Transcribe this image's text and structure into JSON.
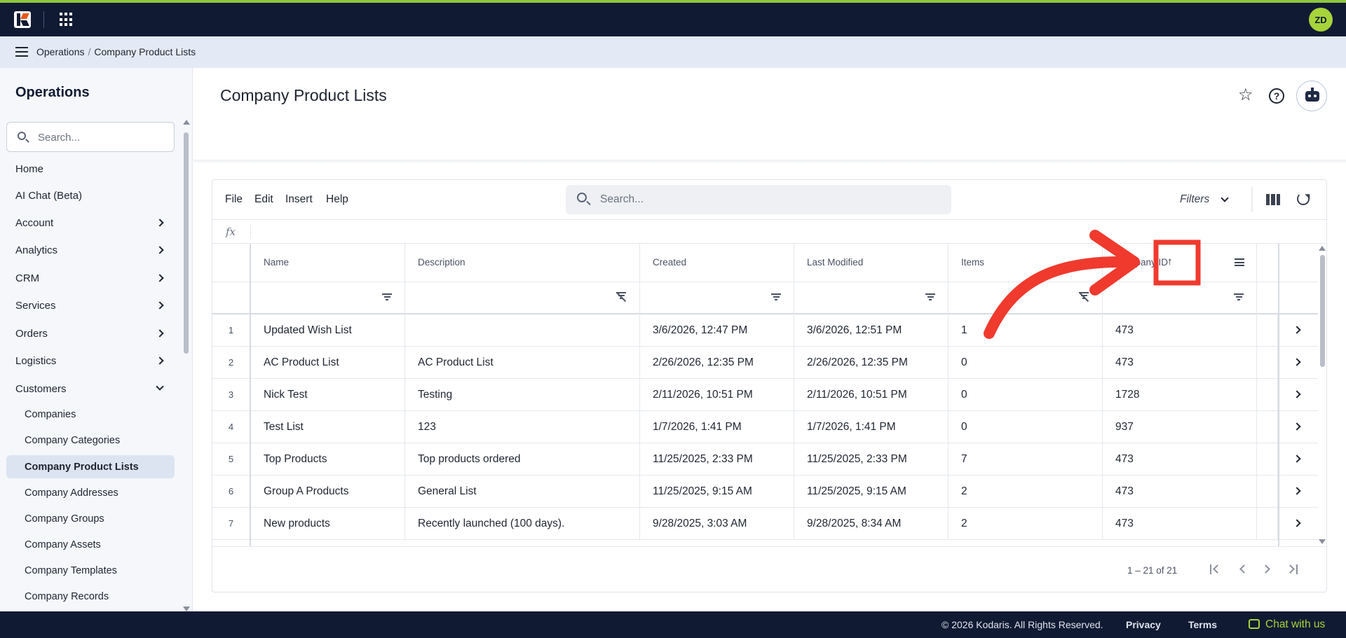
{
  "header": {
    "avatar_initials": "ZD"
  },
  "breadcrumb": {
    "items": [
      "Operations",
      "Company Product Lists"
    ]
  },
  "sidebar": {
    "title": "Operations",
    "search_placeholder": "Search...",
    "items": [
      {
        "label": "Home"
      },
      {
        "label": "AI Chat (Beta)"
      },
      {
        "label": "Account"
      },
      {
        "label": "Analytics"
      },
      {
        "label": "CRM"
      },
      {
        "label": "Services"
      },
      {
        "label": "Orders"
      },
      {
        "label": "Logistics"
      },
      {
        "label": "Customers"
      }
    ],
    "sub_items": [
      {
        "label": "Companies"
      },
      {
        "label": "Company Categories"
      },
      {
        "label": "Company Product Lists"
      },
      {
        "label": "Company Addresses"
      },
      {
        "label": "Company Groups"
      },
      {
        "label": "Company Assets"
      },
      {
        "label": "Company Templates"
      },
      {
        "label": "Company Records"
      }
    ]
  },
  "page": {
    "title": "Company Product Lists"
  },
  "toolbar": {
    "menu": [
      "File",
      "Edit",
      "Insert",
      "Help"
    ],
    "search_placeholder": "Search...",
    "filters_label": "Filters"
  },
  "formula_bar": {
    "label": "fx"
  },
  "table": {
    "columns": [
      "Name",
      "Description",
      "Created",
      "Last Modified",
      "Items",
      "Company ID"
    ],
    "rows": [
      {
        "num": "1",
        "name": "Updated Wish List",
        "description": "",
        "created": "3/6/2026, 12:47 PM",
        "modified": "3/6/2026, 12:51 PM",
        "items": "1",
        "company_id": "473"
      },
      {
        "num": "2",
        "name": "AC Product List",
        "description": "AC Product List",
        "created": "2/26/2026, 12:35 PM",
        "modified": "2/26/2026, 12:35 PM",
        "items": "0",
        "company_id": "473"
      },
      {
        "num": "3",
        "name": "Nick Test",
        "description": "Testing",
        "created": "2/11/2026, 10:51 PM",
        "modified": "2/11/2026, 10:51 PM",
        "items": "0",
        "company_id": "1728"
      },
      {
        "num": "4",
        "name": "Test List",
        "description": "123",
        "created": "1/7/2026, 1:41 PM",
        "modified": "1/7/2026, 1:41 PM",
        "items": "0",
        "company_id": "937"
      },
      {
        "num": "5",
        "name": "Top Products",
        "description": "Top products ordered",
        "created": "11/25/2025, 2:33 PM",
        "modified": "11/25/2025, 2:33 PM",
        "items": "7",
        "company_id": "473"
      },
      {
        "num": "6",
        "name": "Group A Products",
        "description": "General List",
        "created": "11/25/2025, 9:15 AM",
        "modified": "11/25/2025, 9:15 AM",
        "items": "2",
        "company_id": "473"
      },
      {
        "num": "7",
        "name": "New products",
        "description": "Recently launched (100 days).",
        "created": "9/28/2025, 3:03 AM",
        "modified": "9/28/2025, 8:34 AM",
        "items": "2",
        "company_id": "473"
      }
    ]
  },
  "pagination": {
    "text": "1 – 21 of 21"
  },
  "footer": {
    "copyright": "© 2026 Kodaris. All Rights Reserved.",
    "privacy": "Privacy",
    "terms": "Terms",
    "chat": "Chat with us"
  },
  "colors": {
    "topbar": "#111a33",
    "accent": "#8cc63f",
    "avatar": "#a6d43a",
    "annotation": "#f03a2e"
  },
  "icons": [
    "logo",
    "apps-grid-icon",
    "menu-icon",
    "search-icon",
    "chevron-right-icon",
    "star-icon",
    "help-icon",
    "bot-icon",
    "chevron-down-icon",
    "columns-icon",
    "refresh-icon",
    "filter-icon",
    "filter-off-icon",
    "sort-up-icon",
    "column-menu-icon",
    "first-page-icon",
    "prev-page-icon",
    "next-page-icon",
    "last-page-icon",
    "chat-icon"
  ]
}
